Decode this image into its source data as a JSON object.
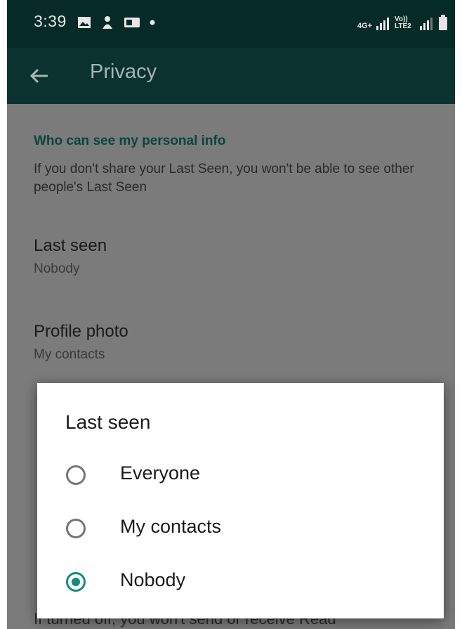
{
  "status_bar": {
    "time": "3:39",
    "left_icons": [
      "gallery-icon",
      "notification-icon",
      "app-icon",
      "dot-icon"
    ],
    "network_label": "4G+",
    "volte_label": "Vo)) LTE2"
  },
  "app_bar": {
    "title": "Privacy"
  },
  "privacy": {
    "section_title": "Who can see my personal info",
    "section_description": "If you don't share your Last Seen, you won't be able to see other people's Last Seen",
    "items": [
      {
        "title": "Last seen",
        "value": "Nobody"
      },
      {
        "title": "Profile photo",
        "value": "My contacts"
      }
    ],
    "bottom_text": "If turned off, you won't send or receive Read"
  },
  "dialog": {
    "title": "Last seen",
    "options": [
      {
        "label": "Everyone",
        "selected": false
      },
      {
        "label": "My contacts",
        "selected": false
      },
      {
        "label": "Nobody",
        "selected": true
      }
    ]
  },
  "colors": {
    "accent": "#128c7e",
    "app_bar": "#075e54",
    "section_title": "#075e54"
  }
}
